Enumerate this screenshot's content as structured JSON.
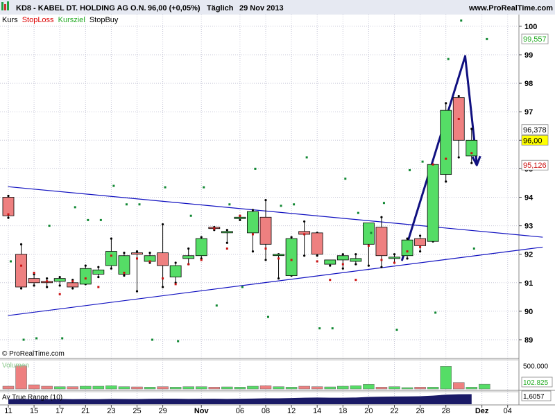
{
  "header": {
    "title": "KD8 - KABEL DT. HOLDING AG O.N.",
    "quote": "96,00 (+0,05%)",
    "period": "Täglich",
    "date": "29 Nov 2013",
    "site": "www.ProRealTime.com"
  },
  "legend": [
    {
      "text": "Kurs",
      "color": "#000000"
    },
    {
      "text": "StopLoss",
      "color": "#dd0000"
    },
    {
      "text": "Kursziel",
      "color": "#22aa22"
    },
    {
      "text": "StopBuy",
      "color": "#000000"
    }
  ],
  "copyright": "© ProRealTime.com",
  "colors": {
    "up": "#55dd66",
    "down": "#ee8080",
    "blue": "#1010c0",
    "arrow": "#101080",
    "green_dot": "#118833",
    "red_dot": "#cc1111",
    "grid": "#c8c8d8",
    "axis_bg": "#ffffff"
  },
  "chart_data": [
    {
      "type": "candlestick",
      "title": "KD8 - KABEL DT. HOLDING AG O.N.",
      "period": "daily",
      "ylim": [
        88.6,
        100.8
      ],
      "yticks": [
        89,
        90,
        91,
        92,
        93,
        94,
        95,
        96,
        97,
        98,
        99,
        100
      ],
      "candles": [
        {
          "open": 94.0,
          "high": 94.05,
          "low": 93.28,
          "close": 93.35
        },
        {
          "open": 92.0,
          "high": 92.35,
          "low": 90.8,
          "close": 90.85
        },
        {
          "open": 91.15,
          "high": 91.3,
          "low": 90.9,
          "close": 91.0
        },
        {
          "open": 91.05,
          "high": 91.15,
          "low": 90.85,
          "close": 91.0
        },
        {
          "open": 91.05,
          "high": 91.2,
          "low": 90.9,
          "close": 91.15
        },
        {
          "open": 91.0,
          "high": 91.1,
          "low": 90.8,
          "close": 90.85
        },
        {
          "open": 90.95,
          "high": 91.6,
          "low": 90.95,
          "close": 91.5
        },
        {
          "open": 91.3,
          "high": 91.55,
          "low": 91.2,
          "close": 91.45
        },
        {
          "open": 91.6,
          "high": 92.55,
          "low": 91.5,
          "close": 92.1
        },
        {
          "open": 91.3,
          "high": 92.05,
          "low": 91.25,
          "close": 91.95
        },
        {
          "open": 92.05,
          "high": 92.1,
          "low": 90.7,
          "close": 92.0
        },
        {
          "open": 91.75,
          "high": 92.05,
          "low": 91.7,
          "close": 91.95
        },
        {
          "open": 92.05,
          "high": 93.05,
          "low": 90.85,
          "close": 91.6
        },
        {
          "open": 91.2,
          "high": 91.7,
          "low": 91.0,
          "close": 91.6
        },
        {
          "open": 91.85,
          "high": 92.2,
          "low": 91.65,
          "close": 91.95
        },
        {
          "open": 91.95,
          "high": 92.6,
          "low": 91.85,
          "close": 92.55
        },
        {
          "open": 92.95,
          "high": 92.95,
          "low": 92.85,
          "close": 92.9
        },
        {
          "open": 92.8,
          "high": 92.85,
          "low": 92.4,
          "close": 92.8
        },
        {
          "open": 93.25,
          "high": 93.35,
          "low": 93.2,
          "close": 93.3
        },
        {
          "open": 92.75,
          "high": 93.55,
          "low": 92.1,
          "close": 93.5
        },
        {
          "open": 93.3,
          "high": 93.9,
          "low": 91.8,
          "close": 92.35
        },
        {
          "open": 92.0,
          "high": 92.0,
          "low": 91.15,
          "close": 92.0
        },
        {
          "open": 91.25,
          "high": 92.6,
          "low": 91.25,
          "close": 92.55
        },
        {
          "open": 92.8,
          "high": 93.15,
          "low": 91.95,
          "close": 92.7
        },
        {
          "open": 92.75,
          "high": 92.75,
          "low": 91.95,
          "close": 92.0
        },
        {
          "open": 91.65,
          "high": 91.7,
          "low": 91.6,
          "close": 91.8
        },
        {
          "open": 91.8,
          "high": 92.0,
          "low": 91.5,
          "close": 91.95
        },
        {
          "open": 91.75,
          "high": 92.0,
          "low": 91.65,
          "close": 91.85
        },
        {
          "open": 92.35,
          "high": 93.05,
          "low": 91.6,
          "close": 93.1
        },
        {
          "open": 92.95,
          "high": 93.3,
          "low": 91.55,
          "close": 91.95
        },
        {
          "open": 91.85,
          "high": 92.0,
          "low": 91.7,
          "close": 91.9
        },
        {
          "open": 91.95,
          "high": 92.55,
          "low": 91.85,
          "close": 92.5
        },
        {
          "open": 92.55,
          "high": 92.65,
          "low": 92.1,
          "close": 92.3
        },
        {
          "open": 92.45,
          "high": 95.15,
          "low": 92.45,
          "close": 95.15
        },
        {
          "open": 94.8,
          "high": 97.3,
          "low": 94.55,
          "close": 97.05
        },
        {
          "open": 97.5,
          "high": 97.55,
          "low": 95.4,
          "close": 96.0
        },
        {
          "open": 95.45,
          "high": 96.4,
          "low": 95.2,
          "close": 96.0
        }
      ],
      "stoploss": [
        93.4,
        91.6,
        91.35,
        91.05,
        90.6,
        91.05,
        91.15,
        90.85,
        91.95,
        91.35,
        91.85,
        91.75,
        91.15,
        90.95,
        91.65,
        91.8,
        92.9,
        92.2,
        93.35,
        92.7,
        92.2,
        91.85,
        91.8,
        92.7,
        91.75,
        91.1,
        91.65,
        91.1,
        92.3,
        91.8,
        91.7,
        92.1,
        92.25,
        95.15,
        95.35,
        96.75,
        95.55
      ],
      "kursziel": [
        91.75,
        89.0,
        89.05,
        93.0,
        89.05,
        93.65,
        93.2,
        93.2,
        94.4,
        93.75,
        93.75,
        89.0,
        94.35,
        88.95,
        93.35,
        94.35,
        90.2,
        93.75,
        90.85,
        95.0,
        89.8,
        93.7,
        93.75,
        95.4,
        89.4,
        89.4,
        94.65,
        93.45,
        92.75,
        93.8,
        89.35,
        94.95,
        95.25,
        89.95,
        98.85,
        100.2,
        92.2,
        99.55
      ],
      "trendlines": [
        {
          "from": {
            "x": 0,
            "y": 94.37
          },
          "to": {
            "x": 41.5,
            "y": 92.6
          }
        },
        {
          "from": {
            "x": 0,
            "y": 89.85
          },
          "to": {
            "x": 41.5,
            "y": 92.25
          }
        },
        {
          "from": {
            "x": 30.6,
            "y": 91.8
          },
          "to": {
            "x": 35.5,
            "y": 98.95
          }
        },
        {
          "from": {
            "x": 35.5,
            "y": 98.95
          },
          "to": {
            "x": 36.4,
            "y": 95.2
          }
        }
      ],
      "price_labels": [
        "99,557",
        "96,378",
        "96,00",
        "95,126"
      ]
    },
    {
      "type": "bar",
      "title": "Volumen",
      "yticks": [
        500000
      ],
      "ytick_labels": [
        "500.000"
      ],
      "current_label": "102.825",
      "ymax": 600000,
      "values": [
        60000,
        500000,
        90000,
        60000,
        50000,
        50000,
        60000,
        60000,
        70000,
        50000,
        45000,
        40000,
        50000,
        40000,
        50000,
        50000,
        40000,
        45000,
        40000,
        60000,
        70000,
        50000,
        40000,
        60000,
        50000,
        45000,
        60000,
        70000,
        100000,
        40000,
        50000,
        30000,
        40000,
        40000,
        490000,
        140000,
        40000,
        102825
      ]
    },
    {
      "type": "area",
      "title": "Av True Range (10)",
      "current_label": "1,6057",
      "ylim": [
        0.5,
        1.8
      ],
      "values": [
        1.05,
        1.08,
        1.06,
        1.05,
        1.07,
        1.05,
        1.06,
        1.05,
        1.08,
        1.07,
        1.06,
        1.09,
        1.1,
        1.1,
        1.08,
        1.09,
        1.1,
        1.08,
        1.1,
        1.12,
        1.15,
        1.15,
        1.18,
        1.22,
        1.24,
        1.22,
        1.22,
        1.24,
        1.3,
        1.33,
        1.35,
        1.36,
        1.38,
        1.45,
        1.55,
        1.6,
        1.6057
      ]
    }
  ],
  "x_axis": {
    "labels": [
      "11",
      "15",
      "17",
      "21",
      "23",
      "25",
      "29",
      "Nov",
      "06",
      "08",
      "12",
      "14",
      "18",
      "20",
      "22",
      "26",
      "28",
      "Dez",
      "04"
    ],
    "label_index": [
      0,
      2,
      4,
      6,
      8,
      10,
      12,
      15,
      18,
      20,
      22,
      24,
      26,
      28,
      30,
      32,
      34,
      36.8,
      38.8
    ]
  }
}
